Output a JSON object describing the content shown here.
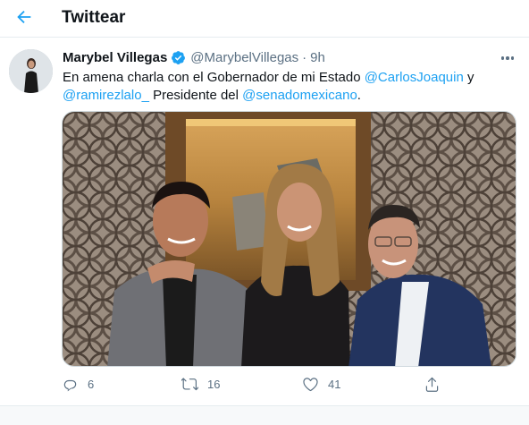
{
  "header": {
    "title": "Twittear",
    "back_icon": "arrow-left-icon",
    "accent_color": "#1da1f2"
  },
  "tweet": {
    "author_name": "Marybel Villegas",
    "verified": true,
    "handle": "@MarybelVillegas",
    "separator": "·",
    "time": "9h",
    "text_parts": {
      "p1": "En amena charla con el Gobernador de mi Estado ",
      "m1": "@CarlosJoaquin",
      "p2": " y ",
      "m2": "@ramirezlalo_",
      "p3": " Presidente del ",
      "m3": "@senadomexicano",
      "p4": "."
    },
    "stats": {
      "replies": "6",
      "retweets": "16",
      "likes": "41"
    }
  }
}
